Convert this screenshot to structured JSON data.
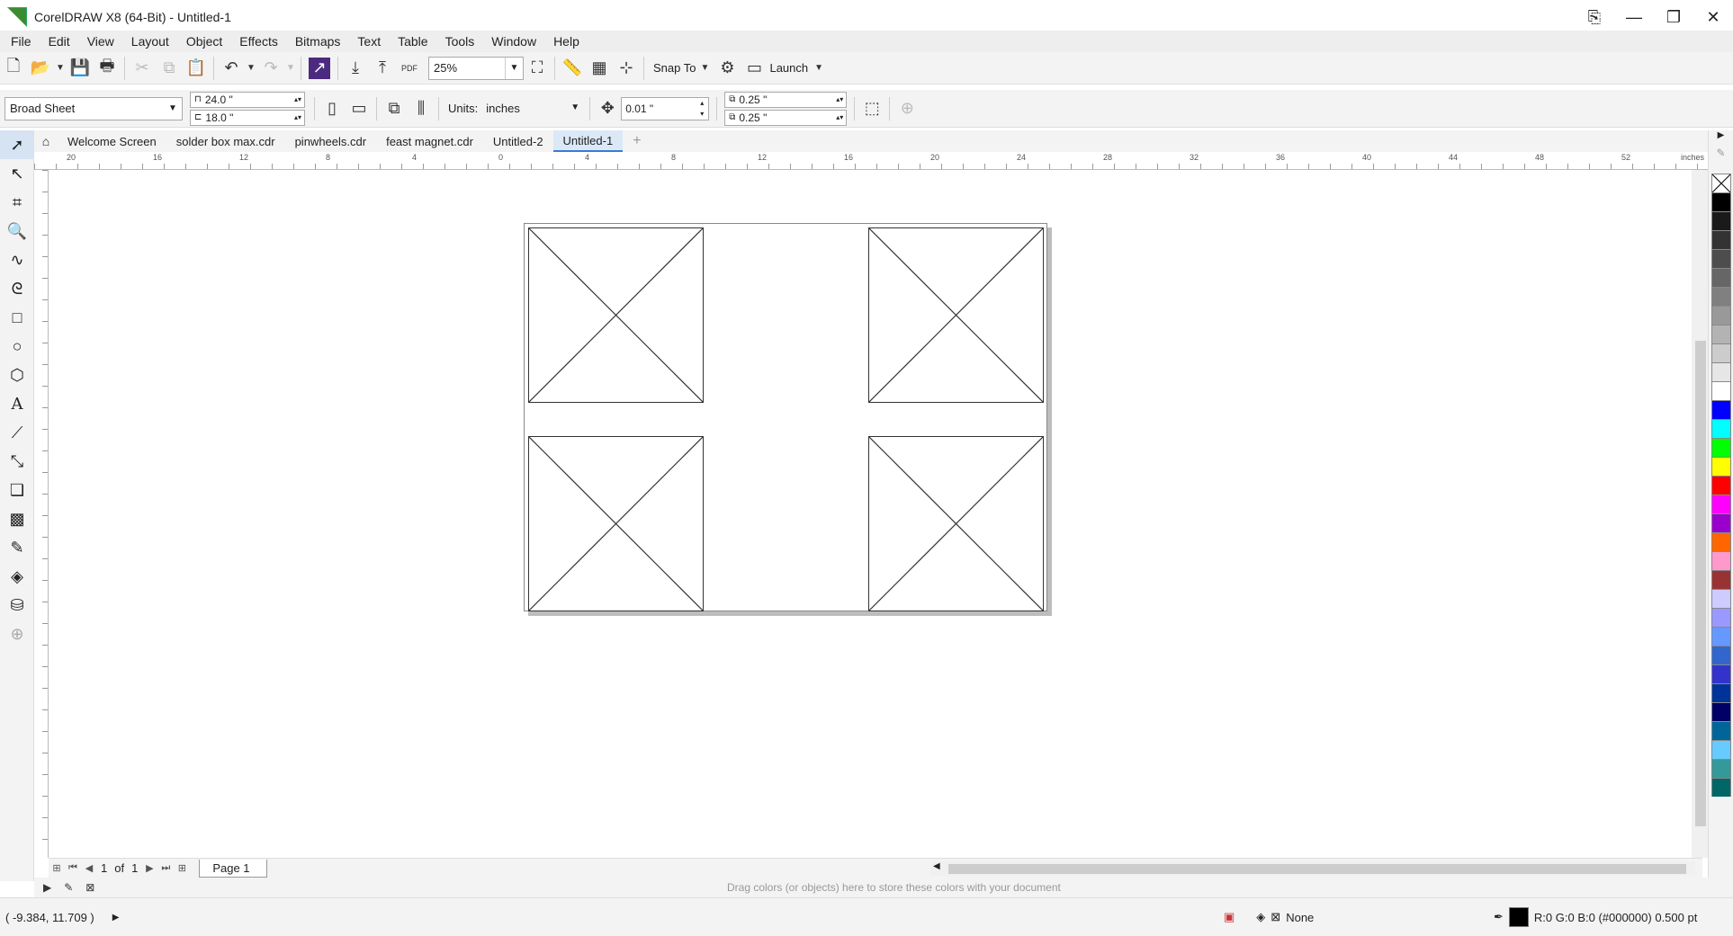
{
  "window": {
    "title": "CorelDRAW X8 (64-Bit) - Untitled-1"
  },
  "menu": [
    "File",
    "Edit",
    "View",
    "Layout",
    "Object",
    "Effects",
    "Bitmaps",
    "Text",
    "Table",
    "Tools",
    "Window",
    "Help"
  ],
  "toolbar": {
    "zoom_value": "25%",
    "snap_label": "Snap To",
    "launch_label": "Launch"
  },
  "property_bar": {
    "page_size": "Broad Sheet",
    "width": "24.0 \"",
    "height": "18.0 \"",
    "units_label": "Units:",
    "units_value": "inches",
    "nudge": "0.01 \"",
    "dup_x": "0.25 \"",
    "dup_y": "0.25 \""
  },
  "tabs": [
    "Welcome Screen",
    "solder box max.cdr",
    "pinwheels.cdr",
    "feast magnet.cdr",
    "Untitled-2",
    "Untitled-1"
  ],
  "active_tab": "Untitled-1",
  "ruler": {
    "unit": "inches",
    "ticks": [
      "20",
      "16",
      "12",
      "8",
      "4",
      "0",
      "4",
      "8",
      "12",
      "16",
      "20",
      "24",
      "28",
      "32",
      "36",
      "40",
      "44",
      "48",
      "52"
    ]
  },
  "page_nav": {
    "current": "1",
    "of_label": "of",
    "total": "1",
    "page_tab": "Page 1"
  },
  "doc_palette_hint": "Drag colors (or objects) here to store these colors with your document",
  "status": {
    "coords": "( -9.384, 11.709 )",
    "fill_label": "None",
    "outline_label": "R:0 G:0 B:0 (#000000)  0.500 pt"
  },
  "palette_colors": [
    "#000000",
    "#1a1a1a",
    "#333333",
    "#4d4d4d",
    "#666666",
    "#808080",
    "#999999",
    "#b3b3b3",
    "#cccccc",
    "#e6e6e6",
    "#ffffff",
    "#0000ff",
    "#00ffff",
    "#00ff00",
    "#ffff00",
    "#ff0000",
    "#ff00ff",
    "#9900cc",
    "#ff6600",
    "#ff99cc",
    "#993333",
    "#ccccff",
    "#9999ff",
    "#6699ff",
    "#3366cc",
    "#3333cc",
    "#003399",
    "#000066",
    "#006699",
    "#66ccff",
    "#339999",
    "#006666"
  ]
}
